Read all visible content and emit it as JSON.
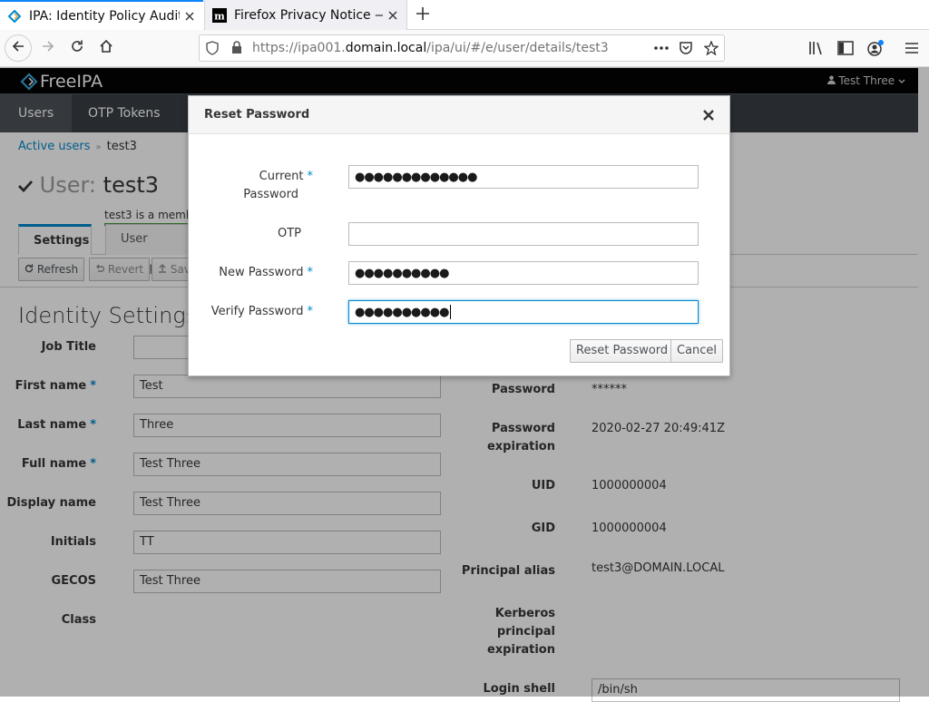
{
  "browser": {
    "tabs": [
      {
        "title": "IPA: Identity Policy Audit",
        "active": true
      },
      {
        "title": "Firefox Privacy Notice —",
        "active": false
      }
    ],
    "url_prefix": "https://ipa001.",
    "url_host": "domain.local",
    "url_path": "/ipa/ui/#/e/user/details/test3"
  },
  "ipa": {
    "logo_text": "FreeIPA",
    "current_user": "Test Three",
    "nav": [
      "Users",
      "OTP Tokens"
    ],
    "breadcrumb": {
      "parent": "Active users",
      "current": "test3"
    },
    "title_prefix": "User:",
    "title_value": "test3",
    "notice": "test3 is a membe",
    "facets": {
      "settings": "Settings",
      "groups": "User Groups"
    },
    "toolbar": {
      "refresh": "Refresh",
      "revert": "Revert",
      "save": "Sav"
    },
    "section_title": "Identity Settings",
    "fields": [
      {
        "label": "Job Title",
        "value": "",
        "required": false
      },
      {
        "label": "First name",
        "value": "Test",
        "required": true
      },
      {
        "label": "Last name",
        "value": "Three",
        "required": true
      },
      {
        "label": "Full name",
        "value": "Test Three",
        "required": true
      },
      {
        "label": "Display name",
        "value": "Test Three",
        "required": false
      },
      {
        "label": "Initials",
        "value": "TT",
        "required": false
      },
      {
        "label": "GECOS",
        "value": "Test Three",
        "required": false
      },
      {
        "label": "Class",
        "value": "",
        "required": false
      }
    ],
    "account": {
      "password_label": "Password",
      "password_value": "******",
      "pwexp_label_1": "Password",
      "pwexp_label_2": "expiration",
      "pwexp_value": "2020-02-27 20:49:41Z",
      "uid_label": "UID",
      "uid_value": "1000000004",
      "gid_label": "GID",
      "gid_value": "1000000004",
      "principal_label": "Principal alias",
      "principal_value": "test3@DOMAIN.LOCAL",
      "krb_label_1": "Kerberos",
      "krb_label_2": "principal",
      "krb_label_3": "expiration",
      "shell_label": "Login shell",
      "shell_value": "/bin/sh"
    }
  },
  "dialog": {
    "title": "Reset Password",
    "fields": {
      "current_label_1": "Current",
      "current_label_2": "Password",
      "current_value": "●●●●●●●●●●●●●",
      "otp_label": "OTP",
      "otp_value": "",
      "new_label": "New Password",
      "new_value": "●●●●●●●●●●",
      "verify_label": "Verify Password",
      "verify_value": "●●●●●●●●●●"
    },
    "required_mark": "*",
    "buttons": {
      "reset": "Reset Password",
      "cancel": "Cancel"
    }
  },
  "colors": {
    "accent": "#0088ce",
    "focus": "#0a84ff",
    "nav_bg": "#393f44",
    "header_bg": "#030303"
  },
  "icons": [
    "freeipa-favicon",
    "mozilla-favicon",
    "close-icon",
    "plus-icon",
    "back-icon",
    "forward-icon",
    "reload-icon",
    "home-icon",
    "shield-icon",
    "lock-icon",
    "more-icon",
    "pocket-icon",
    "star-icon",
    "library-icon",
    "sidebar-icon",
    "account-icon",
    "menu-icon",
    "user-icon",
    "check-icon",
    "refresh-icon",
    "revert-icon",
    "upload-icon"
  ]
}
